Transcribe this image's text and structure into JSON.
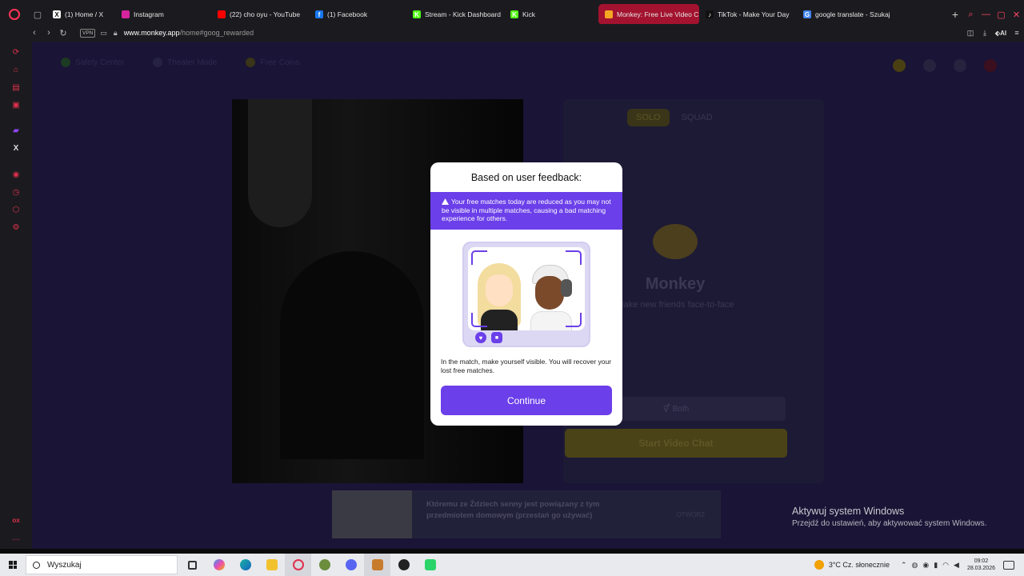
{
  "browser": {
    "tabs": [
      {
        "label": "(1) Home / X",
        "icon": "x-icon",
        "color": "#ffffff",
        "glyph": "X"
      },
      {
        "label": "Instagram",
        "icon": "instagram-icon",
        "color": "#d6249f",
        "glyph": ""
      },
      {
        "label": "(22) cho oyu - YouTube",
        "icon": "youtube-icon",
        "color": "#ff0000",
        "glyph": ""
      },
      {
        "label": "(1) Facebook",
        "icon": "facebook-icon",
        "color": "#1877f2",
        "glyph": "f"
      },
      {
        "label": "Stream - Kick Dashboard",
        "icon": "kick-icon",
        "color": "#53fc18",
        "glyph": "K"
      },
      {
        "label": "Kick",
        "icon": "kick-icon",
        "color": "#53fc18",
        "glyph": "K"
      },
      {
        "label": "Monkey: Free Live Video C",
        "icon": "monkey-icon",
        "color": "#f5a623",
        "glyph": "",
        "active": true
      },
      {
        "label": "TikTok - Make Your Day",
        "icon": "tiktok-icon",
        "color": "#111111",
        "glyph": "♪"
      },
      {
        "label": "google translate - Szukaj",
        "icon": "google-icon",
        "color": "#4285f4",
        "glyph": "G"
      }
    ],
    "vpn_label": "VPN",
    "url_host": "www.monkey.app",
    "url_path": "/home#goog_rewarded",
    "ai_label": "Aria"
  },
  "page": {
    "solo_label": "SOLO",
    "squad_label": "SQUAD",
    "app_name": "Monkey",
    "tagline": "Make new friends face-to-face",
    "both_label": "Both",
    "start_label": "Start Video Chat",
    "ad_text": "Któremu ze Ździech senny jest powiązany z tym przedmiotem domowym (przestań go używać)",
    "ad_cta": "OTWÓRZ"
  },
  "modal": {
    "title": "Based on user feedback:",
    "alert": "Your free matches today are reduced as you may not be visible in multiple matches, causing a bad matching experience for others.",
    "note": "In the match, make yourself visible. You will recover your lost free matches.",
    "continue_label": "Continue",
    "accent": "#6b3fe9"
  },
  "windows": {
    "activate_title": "Aktywuj system Windows",
    "activate_sub": "Przejdź do ustawień, aby aktywować system Windows."
  },
  "taskbar": {
    "search_placeholder": "Wyszukaj",
    "weather": "3°C  Cz. słonecznie",
    "time": "09:02",
    "date": "28.03.2026"
  }
}
